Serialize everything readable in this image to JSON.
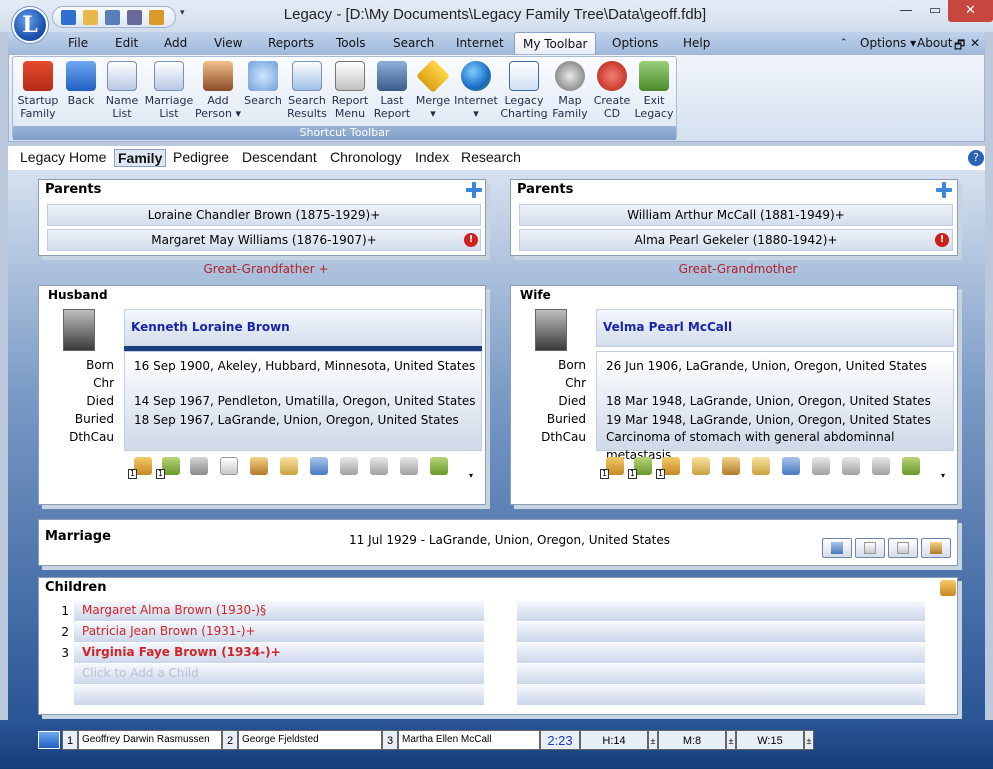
{
  "window": {
    "title": "Legacy - [D:\\My Documents\\Legacy Family Tree\\Data\\geoff.fdb]",
    "logo_letter": "L",
    "qat_dropdown": "▾",
    "minimize": "—",
    "maximize": "▭",
    "close": "✕"
  },
  "menu": {
    "file": "File",
    "edit": "Edit",
    "add": "Add",
    "view": "View",
    "reports": "Reports",
    "tools": "Tools",
    "search": "Search",
    "internet": "Internet",
    "my_toolbar": "My Toolbar",
    "options": "Options",
    "help": "Help",
    "right_options": "Options ▾",
    "right_about": "About",
    "right_restore": "🗗",
    "right_close": "✕",
    "right_up": "⌃"
  },
  "toolbar": {
    "group_label": "Shortcut Toolbar",
    "buttons": [
      {
        "line1": "Startup",
        "line2": "Family",
        "icon": "house-icon"
      },
      {
        "line1": "Back",
        "line2": "",
        "icon": "back-arrow-icon"
      },
      {
        "line1": "Name",
        "line2": "List",
        "icon": "name-list-icon"
      },
      {
        "line1": "Marriage",
        "line2": "List",
        "icon": "marriage-list-icon"
      },
      {
        "line1": "Add",
        "line2": "Person ▾",
        "icon": "add-person-icon"
      },
      {
        "line1": "Search",
        "line2": "",
        "icon": "magnifier-icon"
      },
      {
        "line1": "Search",
        "line2": "Results",
        "icon": "search-results-icon"
      },
      {
        "line1": "Report",
        "line2": "Menu",
        "icon": "report-menu-icon"
      },
      {
        "line1": "Last",
        "line2": "Report",
        "icon": "last-report-icon"
      },
      {
        "line1": "Merge",
        "line2": "▾",
        "icon": "merge-sign-icon"
      },
      {
        "line1": "Internet",
        "line2": "▾",
        "icon": "globe-icon"
      },
      {
        "line1": "Legacy",
        "line2": "Charting",
        "icon": "charting-icon"
      },
      {
        "line1": "Map",
        "line2": "Family",
        "icon": "map-icon"
      },
      {
        "line1": "Create",
        "line2": "CD",
        "icon": "cd-icon"
      },
      {
        "line1": "Exit",
        "line2": "Legacy",
        "icon": "exit-door-icon"
      }
    ]
  },
  "tabs": {
    "legacy_home": "Legacy Home",
    "family": "Family",
    "pedigree": "Pedigree",
    "descendant": "Descendant",
    "chronology": "Chronology",
    "index": "Index",
    "research": "Research"
  },
  "help_label": "?",
  "husband_parents": {
    "title": "Parents",
    "father": "Loraine Chandler Brown (1875-1929)+",
    "mother": "Margaret May Williams (1876-1907)+",
    "relation": "Great-Grandfather +",
    "warn": "!"
  },
  "wife_parents": {
    "title": "Parents",
    "father": "William Arthur McCall (1881-1949)+",
    "mother": "Alma Pearl Gekeler (1880-1942)+",
    "relation": "Great-Grandmother",
    "warn": "!"
  },
  "event_labels": {
    "born": "Born",
    "chr": "Chr",
    "died": "Died",
    "buried": "Buried",
    "dthcau": "DthCau"
  },
  "husband": {
    "title": "Husband",
    "name": "Kenneth Loraine Brown",
    "born": "16 Sep 1900, Akeley, Hubbard, Minnesota, United States",
    "chr": "",
    "died": "14 Sep 1967, Pendleton, Umatilla, Oregon, United States",
    "buried": "18 Sep 1967, LaGrande, Union, Oregon, United States",
    "dthcau": "",
    "badge1": "1",
    "badge2": "1",
    "more": "▾"
  },
  "wife": {
    "title": "Wife",
    "name": "Velma Pearl McCall",
    "born": "26 Jun 1906, LaGrande, Union, Oregon, United States",
    "chr": "",
    "died": "18 Mar 1948, LaGrande, Union, Oregon, United States",
    "buried": "19 Mar 1948, LaGrande, Union, Oregon, United States",
    "dthcau": "Carcinoma of stomach with general abdominnal metastasis",
    "badge1": "1",
    "badge2": "1",
    "badge3": "1",
    "more": "▾"
  },
  "marriage": {
    "title": "Marriage",
    "event": "11 Jul 1929 - LaGrande, Union, Oregon, United States"
  },
  "children": {
    "title": "Children",
    "items": [
      {
        "num": "1",
        "name": "Margaret Alma Brown (1930-)§"
      },
      {
        "num": "2",
        "name": "Patricia Jean Brown (1931-)+"
      },
      {
        "num": "3",
        "name": "Virginia Faye Brown (1934-)+"
      }
    ],
    "add_placeholder": "Click to Add a Child"
  },
  "status": {
    "p1_num": "1",
    "p1": "Geoffrey Darwin Rasmussen",
    "p2_num": "2",
    "p2": "George Fjeldsted",
    "p3_num": "3",
    "p3": "Martha Ellen McCall",
    "time": "2:23",
    "h": "H:14",
    "m": "M:8",
    "w": "W:15",
    "h_mark": "±",
    "m_mark": "±",
    "w_mark": "±"
  },
  "colors": {
    "relation_red": "#b0242a",
    "name_blue": "#1a24a8",
    "child_red": "#d0242a",
    "status_time_blue": "#1d3fc0"
  }
}
